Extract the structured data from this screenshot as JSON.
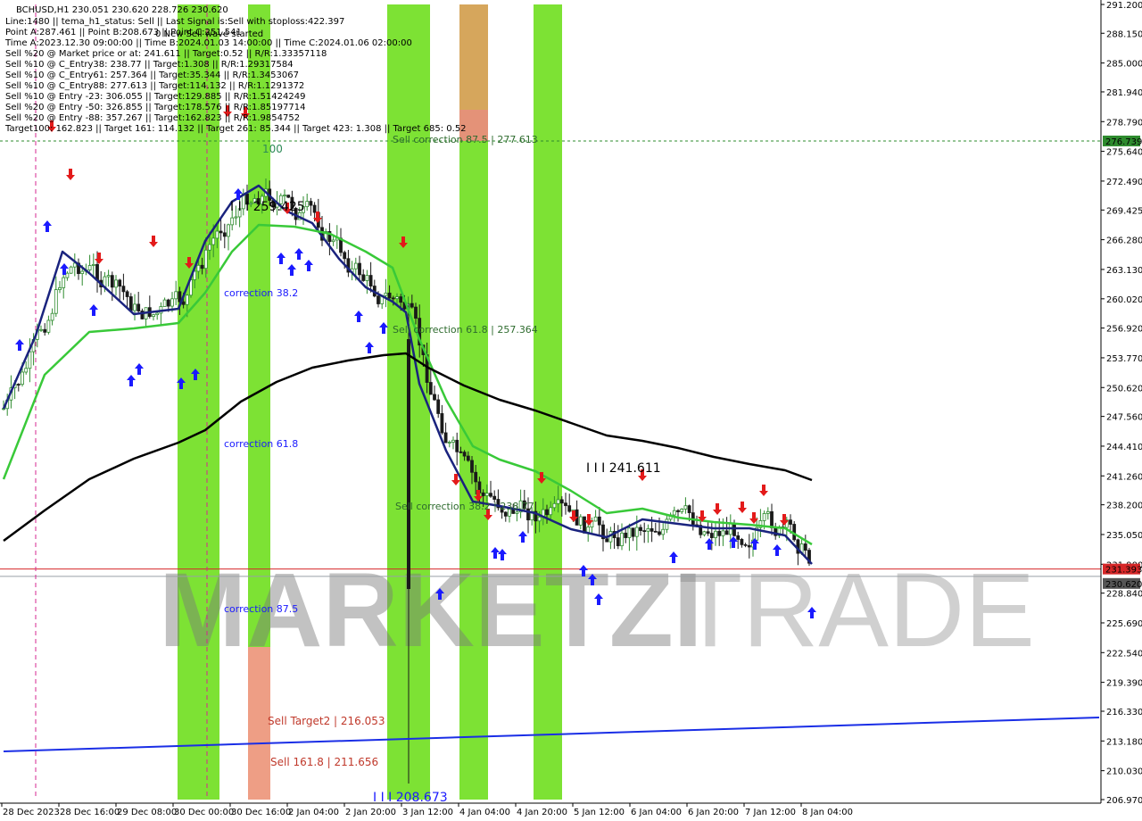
{
  "chart_data": {
    "type": "candlestick",
    "symbol": "BCHUSD,H1",
    "ylim": [
      206.97,
      291.2
    ],
    "price_ticks": [
      "291.200",
      "288.150",
      "285.000",
      "281.940",
      "278.790",
      "275.640",
      "272.490",
      "269.425",
      "266.280",
      "263.130",
      "260.020",
      "256.920",
      "253.770",
      "250.620",
      "247.560",
      "244.410",
      "241.260",
      "238.200",
      "235.050",
      "231.900",
      "228.840",
      "225.690",
      "222.540",
      "219.390",
      "216.330",
      "213.180",
      "210.030",
      "206.970"
    ],
    "time_ticks": [
      "28 Dec 2023",
      "28 Dec 16:00",
      "29 Dec 08:00",
      "30 Dec 00:00",
      "30 Dec 16:00",
      "2 Jan 04:00",
      "2 Jan 20:00",
      "3 Jan 12:00",
      "4 Jan 04:00",
      "4 Jan 20:00",
      "5 Jan 12:00",
      "6 Jan 04:00",
      "6 Jan 20:00",
      "7 Jan 12:00",
      "8 Jan 04:00"
    ],
    "info_lines": [
      "BCHUSD,H1  230.051  230.620  228.726  230.620",
      "Line:1480  ||  tema_h1_status: Sell  ||  Last Signal is:Sell with stoploss:422.397",
      "Point A:287.461  ||  Point B:208.673  ||  Point C:251.541",
      "Time A:2023.12.30 09:00:00  ||  Time B:2024.01.03 14:00:00  ||  Time C:2024.01.06 02:00:00",
      "Sell %20 @ Market price or at: 241.611  ||  Target:0.52  ||  R/R:1.33357118",
      "Sell %10 @ C_Entry38: 238.77  ||  Target:1.308  ||  R/R:1.29317584",
      "Sell %10 @ C_Entry61: 257.364  ||  Target:35.344  ||  R/R:1.3453067",
      "Sell %10 @ C_Entry88: 277.613  ||  Target:114.132  ||  R/R:1.1291372",
      "Sell %10 @ Entry -23: 306.055  ||  Target:129.885  ||  R/R:1.51424249",
      "Sell %20 @ Entry -50: 326.855  ||  Target:178.576  ||  R/R:1.85197714",
      "Sell %20 @ Entry -88: 357.267  ||  Target:162.823  ||  R/R:1.9854752",
      "Target100: 162.823  ||  Target 161: 114.132  ||  Target 261: 85.344  ||  Target 423: 1.308  ||  Target 685: 0.52"
    ],
    "wave_label": "0 New Sell wave started",
    "annotations": [
      {
        "text": "Sell correction 87.5 | 277.613",
        "color": "#2e6b2e"
      },
      {
        "text": "Sell correction 61.8 | 257.364",
        "color": "#2e6b2e"
      },
      {
        "text": "Sell correction 38.2 | 238.77",
        "color": "#2e6b2e"
      },
      {
        "text": "correction 38.2",
        "color": "#1a1aff"
      },
      {
        "text": "correction 61.8",
        "color": "#1a1aff"
      },
      {
        "text": "correction 87.5",
        "color": "#1a1aff"
      },
      {
        "text": "Sell Target2 | 216.053",
        "color": "#c0392b"
      },
      {
        "text": "Sell 161.8 | 211.656",
        "color": "#c0392b"
      },
      {
        "text": "100",
        "color": "#2e8b57"
      },
      {
        "text": "I I I 259.425",
        "color": "#000000"
      },
      {
        "text": "I I I 241.611",
        "color": "#000000"
      },
      {
        "text": "I I I 208.673",
        "color": "#1a1aff"
      }
    ],
    "price_labels": [
      {
        "price": 276.739,
        "text": "276.739",
        "bg": "#2e8b2e"
      },
      {
        "price": 231.393,
        "text": "231.393",
        "bg": "#d62728"
      },
      {
        "price": 230.62,
        "text": "230.620",
        "bg": "#555555"
      }
    ],
    "watermark": {
      "left": "MARKETZI",
      "right": "TRADE"
    },
    "colors": {
      "bull": "#2e8b2e",
      "bear": "#1a1a1a",
      "ema_blue": "#1a237e",
      "ema_green": "#39c939",
      "ma_black": "#000000",
      "trend_blue": "#1a2ee6"
    },
    "bands": [
      {
        "x0": 199,
        "x1": 246,
        "color": "#66dd11",
        "alpha": 0.85
      },
      {
        "x0": 278,
        "x1": 303,
        "color": "#66dd11",
        "alpha": 0.85
      },
      {
        "x0": 434,
        "x1": 482,
        "color": "#66dd11",
        "alpha": 0.85
      },
      {
        "x0": 515,
        "x1": 547,
        "color": "#66dd11",
        "alpha": 0.85
      },
      {
        "x0": 598,
        "x1": 630,
        "color": "#66dd11",
        "alpha": 0.85
      }
    ],
    "series": [
      {
        "name": "ema_blue",
        "points": [
          [
            4,
            458
          ],
          [
            40,
            376
          ],
          [
            70,
            282
          ],
          [
            100,
            306
          ],
          [
            150,
            352
          ],
          [
            200,
            346
          ],
          [
            230,
            270
          ],
          [
            260,
            226
          ],
          [
            290,
            208
          ],
          [
            320,
            236
          ],
          [
            350,
            250
          ],
          [
            380,
            290
          ],
          [
            410,
            322
          ],
          [
            440,
            338
          ],
          [
            455,
            350
          ],
          [
            470,
            430
          ],
          [
            500,
            505
          ],
          [
            530,
            562
          ],
          [
            560,
            567
          ],
          [
            600,
            575
          ],
          [
            640,
            593
          ],
          [
            680,
            602
          ],
          [
            720,
            582
          ],
          [
            760,
            587
          ],
          [
            800,
            592
          ],
          [
            840,
            592
          ],
          [
            880,
            600
          ],
          [
            910,
            632
          ]
        ]
      },
      {
        "name": "ema_green",
        "points": [
          [
            4,
            537
          ],
          [
            50,
            420
          ],
          [
            100,
            372
          ],
          [
            150,
            368
          ],
          [
            200,
            362
          ],
          [
            230,
            328
          ],
          [
            260,
            282
          ],
          [
            290,
            252
          ],
          [
            330,
            254
          ],
          [
            370,
            262
          ],
          [
            410,
            282
          ],
          [
            440,
            300
          ],
          [
            470,
            380
          ],
          [
            500,
            448
          ],
          [
            530,
            500
          ],
          [
            560,
            515
          ],
          [
            600,
            528
          ],
          [
            640,
            550
          ],
          [
            680,
            575
          ],
          [
            720,
            570
          ],
          [
            760,
            580
          ],
          [
            800,
            585
          ],
          [
            840,
            588
          ],
          [
            880,
            592
          ],
          [
            910,
            610
          ]
        ]
      },
      {
        "name": "ma_black",
        "points": [
          [
            4,
            606
          ],
          [
            50,
            572
          ],
          [
            100,
            537
          ],
          [
            150,
            514
          ],
          [
            200,
            496
          ],
          [
            230,
            482
          ],
          [
            270,
            450
          ],
          [
            310,
            428
          ],
          [
            350,
            412
          ],
          [
            390,
            404
          ],
          [
            430,
            398
          ],
          [
            455,
            396
          ],
          [
            480,
            412
          ],
          [
            520,
            432
          ],
          [
            560,
            448
          ],
          [
            600,
            460
          ],
          [
            640,
            474
          ],
          [
            680,
            488
          ],
          [
            720,
            494
          ],
          [
            760,
            502
          ],
          [
            800,
            512
          ],
          [
            840,
            520
          ],
          [
            880,
            527
          ],
          [
            910,
            538
          ]
        ]
      },
      {
        "name": "trend_blue",
        "points": [
          [
            4,
            842
          ],
          [
            1232,
            804
          ]
        ]
      }
    ],
    "hlines": [
      {
        "price": 276.739,
        "color": "#2e8b2e",
        "dash": "3,3"
      },
      {
        "price": 231.393,
        "color": "#d62728",
        "dash": ""
      },
      {
        "price": 230.62,
        "color": "#9aa0a6",
        "dash": ""
      }
    ],
    "vlines": [
      {
        "x": 40
      },
      {
        "x": 232
      }
    ]
  }
}
